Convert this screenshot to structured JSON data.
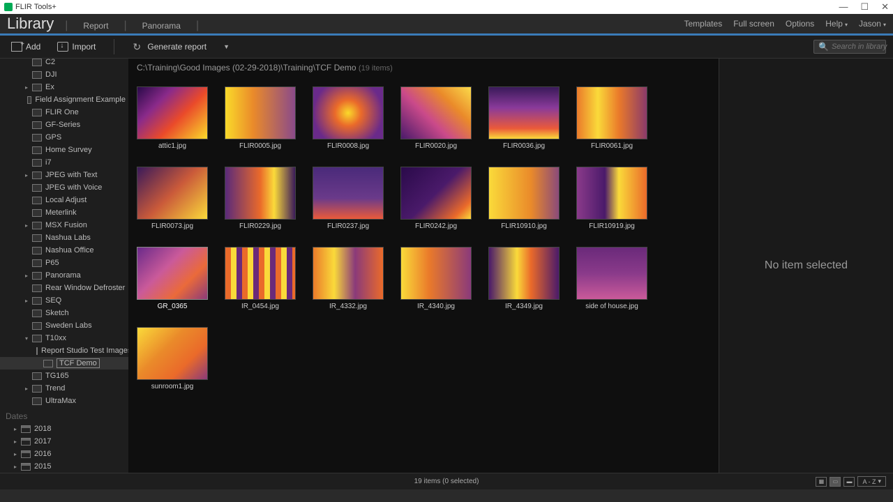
{
  "window": {
    "title": "FLIR Tools+"
  },
  "menubar": {
    "title": "Library",
    "left": [
      "Report",
      "Panorama"
    ],
    "right": [
      "Templates",
      "Full screen",
      "Options",
      "Help",
      "Jason"
    ]
  },
  "toolbar": {
    "add": "Add",
    "import": "Import",
    "generate": "Generate report",
    "search_placeholder": "Search in library"
  },
  "tree": [
    {
      "label": "C2",
      "expand": "",
      "indent": 2
    },
    {
      "label": "DJI",
      "expand": "",
      "indent": 2
    },
    {
      "label": "Ex",
      "expand": "▸",
      "indent": 2
    },
    {
      "label": "Field Assignment Example",
      "expand": "",
      "indent": 2
    },
    {
      "label": "FLIR One",
      "expand": "",
      "indent": 2
    },
    {
      "label": "GF-Series",
      "expand": "",
      "indent": 2
    },
    {
      "label": "GPS",
      "expand": "",
      "indent": 2
    },
    {
      "label": "Home Survey",
      "expand": "",
      "indent": 2
    },
    {
      "label": "i7",
      "expand": "",
      "indent": 2
    },
    {
      "label": "JPEG with Text",
      "expand": "▸",
      "indent": 2
    },
    {
      "label": "JPEG with Voice",
      "expand": "",
      "indent": 2
    },
    {
      "label": "Local Adjust",
      "expand": "",
      "indent": 2
    },
    {
      "label": "Meterlink",
      "expand": "",
      "indent": 2
    },
    {
      "label": "MSX Fusion",
      "expand": "▸",
      "indent": 2
    },
    {
      "label": "Nashua Labs",
      "expand": "",
      "indent": 2
    },
    {
      "label": "Nashua Office",
      "expand": "",
      "indent": 2
    },
    {
      "label": "P65",
      "expand": "",
      "indent": 2
    },
    {
      "label": "Panorama",
      "expand": "▸",
      "indent": 2
    },
    {
      "label": "Rear Window Defroster",
      "expand": "",
      "indent": 2
    },
    {
      "label": "SEQ",
      "expand": "▸",
      "indent": 2
    },
    {
      "label": "Sketch",
      "expand": "",
      "indent": 2
    },
    {
      "label": "Sweden Labs",
      "expand": "",
      "indent": 2
    },
    {
      "label": "T10xx",
      "expand": "▾",
      "indent": 2
    },
    {
      "label": "Report Studio Test Images",
      "expand": "",
      "indent": 3
    },
    {
      "label": "TCF Demo",
      "expand": "",
      "indent": 3,
      "selected": true
    },
    {
      "label": "TG165",
      "expand": "",
      "indent": 2
    },
    {
      "label": "Trend",
      "expand": "▸",
      "indent": 2
    },
    {
      "label": "UltraMax",
      "expand": "",
      "indent": 2
    }
  ],
  "dates_header": "Dates",
  "dates": [
    "2018",
    "2017",
    "2016",
    "2015"
  ],
  "breadcrumb": {
    "path": "C:\\Training\\Good Images (02-29-2018)\\Training\\TCF Demo",
    "count": "(19 items)"
  },
  "thumbs": [
    {
      "name": "attic1.jpg",
      "t": "t1"
    },
    {
      "name": "FLIR0005.jpg",
      "t": "t2"
    },
    {
      "name": "FLIR0008.jpg",
      "t": "t3"
    },
    {
      "name": "FLIR0020.jpg",
      "t": "t4"
    },
    {
      "name": "FLIR0036.jpg",
      "t": "t5"
    },
    {
      "name": "FLIR0061.jpg",
      "t": "t6"
    },
    {
      "name": "FLIR0073.jpg",
      "t": "t7"
    },
    {
      "name": "FLIR0229.jpg",
      "t": "t8"
    },
    {
      "name": "FLIR0237.jpg",
      "t": "t9"
    },
    {
      "name": "FLIR0242.jpg",
      "t": "t10"
    },
    {
      "name": "FLIR10910.jpg",
      "t": "t11"
    },
    {
      "name": "FLIR10919.jpg",
      "t": "t12"
    },
    {
      "name": "GR_0365",
      "t": "t13",
      "selected": true
    },
    {
      "name": "IR_0454.jpg",
      "t": "t14"
    },
    {
      "name": "IR_4332.jpg",
      "t": "t15"
    },
    {
      "name": "IR_4340.jpg",
      "t": "t16"
    },
    {
      "name": "IR_4349.jpg",
      "t": "t17"
    },
    {
      "name": "side of house.jpg",
      "t": "t18"
    },
    {
      "name": "sunroom1.jpg",
      "t": "t19"
    }
  ],
  "detail": {
    "empty": "No item selected"
  },
  "statusbar": {
    "text": "19 items   (0 selected)",
    "sort": "A - Z"
  }
}
